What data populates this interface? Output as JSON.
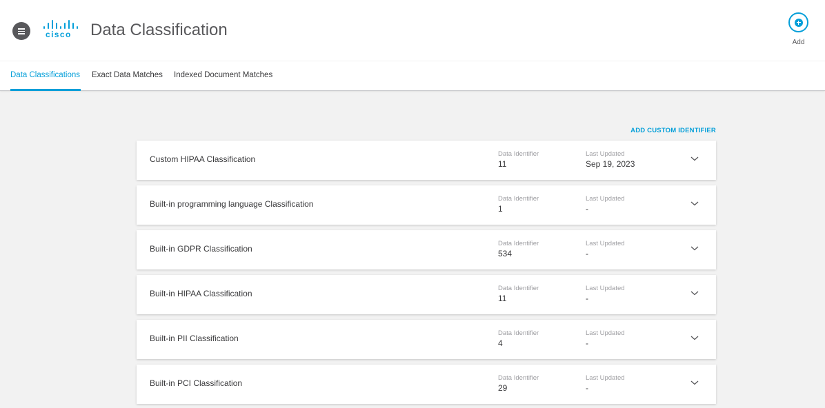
{
  "header": {
    "menu_icon": "hamburger-menu-icon",
    "brand": "cisco",
    "title": "Data Classification",
    "add_label": "Add",
    "add_icon": "plus-circle-icon"
  },
  "tabs": [
    {
      "label": "Data Classifications",
      "active": true
    },
    {
      "label": "Exact Data Matches",
      "active": false
    },
    {
      "label": "Indexed Document Matches",
      "active": false
    }
  ],
  "actions": {
    "add_custom_identifier": "ADD CUSTOM IDENTIFIER"
  },
  "columns": {
    "data_identifier": "Data Identifier",
    "last_updated": "Last Updated"
  },
  "classifications": [
    {
      "name": "Custom HIPAA Classification",
      "data_identifier": "11",
      "last_updated": "Sep 19, 2023"
    },
    {
      "name": "Built-in programming language Classification",
      "data_identifier": "1",
      "last_updated": "-"
    },
    {
      "name": "Built-in GDPR Classification",
      "data_identifier": "534",
      "last_updated": "-"
    },
    {
      "name": "Built-in HIPAA Classification",
      "data_identifier": "11",
      "last_updated": "-"
    },
    {
      "name": "Built-in PII Classification",
      "data_identifier": "4",
      "last_updated": "-"
    },
    {
      "name": "Built-in PCI Classification",
      "data_identifier": "29",
      "last_updated": "-"
    }
  ],
  "colors": {
    "accent": "#049fd9",
    "text": "#39393b",
    "muted": "#9e9ea2",
    "background": "#f2f2f2"
  }
}
